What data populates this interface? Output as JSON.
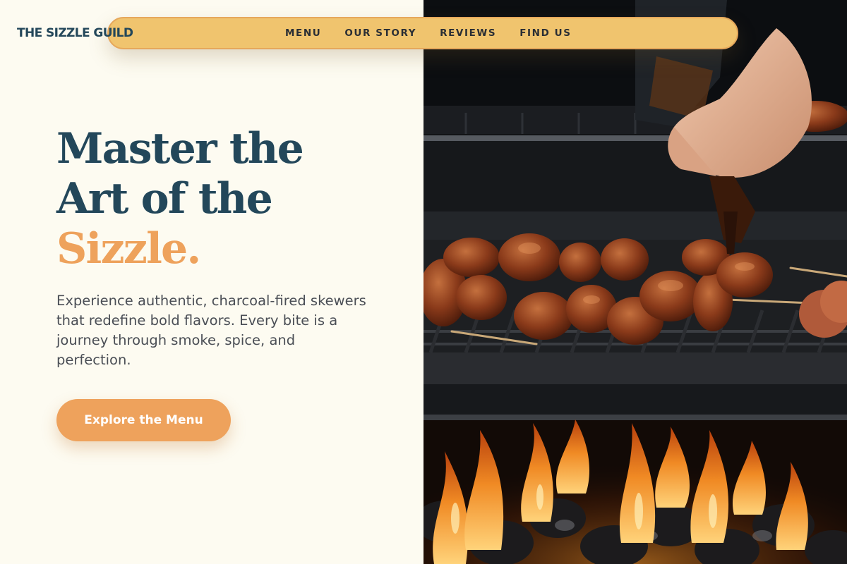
{
  "brand": {
    "name": "THE SIZZLE GUILD"
  },
  "nav": {
    "items": [
      {
        "label": "MENU"
      },
      {
        "label": "OUR STORY"
      },
      {
        "label": "REVIEWS"
      },
      {
        "label": "FIND US"
      }
    ]
  },
  "hero": {
    "headline_line1": "Master the",
    "headline_line2": "Art of the",
    "headline_accent": "Sizzle.",
    "description": "Experience authentic, charcoal-fired skewers that redefine bold flavors. Every bite is a journey through smoke, spice, and perfection.",
    "cta_label": "Explore the Menu",
    "image": {
      "subject": "grilled skewers over open flames"
    }
  },
  "colors": {
    "background": "#fdfbf1",
    "navy": "#23475a",
    "accent_orange": "#eea25c",
    "nav_gold": "#f0c46e"
  }
}
